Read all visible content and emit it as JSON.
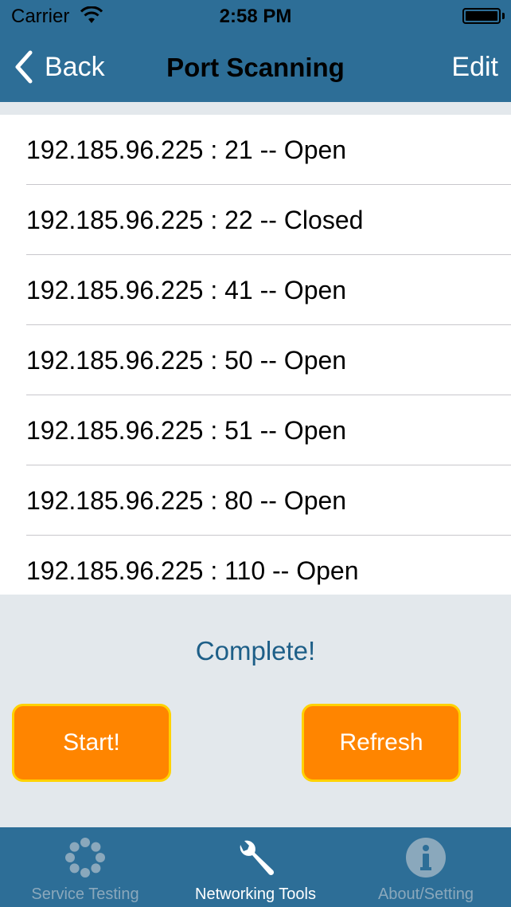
{
  "status_bar": {
    "carrier": "Carrier",
    "time": "2:58 PM"
  },
  "nav": {
    "back_label": "Back",
    "title": "Port Scanning",
    "edit_label": "Edit"
  },
  "results": [
    "192.185.96.225 : 21 -- Open",
    "192.185.96.225 : 22 -- Closed",
    "192.185.96.225 : 41 -- Open",
    "192.185.96.225 : 50 -- Open",
    "192.185.96.225 : 51 -- Open",
    "192.185.96.225 : 80 -- Open",
    "192.185.96.225 : 110 -- Open"
  ],
  "scan_status": "Complete!",
  "buttons": {
    "start_label": "Start!",
    "refresh_label": "Refresh"
  },
  "tabs": [
    {
      "label": "Service Testing",
      "icon": "spinner-icon",
      "active": false
    },
    {
      "label": "Networking Tools",
      "icon": "wrench-icon",
      "active": true
    },
    {
      "label": "About/Setting",
      "icon": "info-icon",
      "active": false
    }
  ],
  "colors": {
    "bar_blue": "#2d6e97",
    "button_orange": "#ff8500",
    "button_border": "#ffd200",
    "status_text": "#1e5f88"
  }
}
